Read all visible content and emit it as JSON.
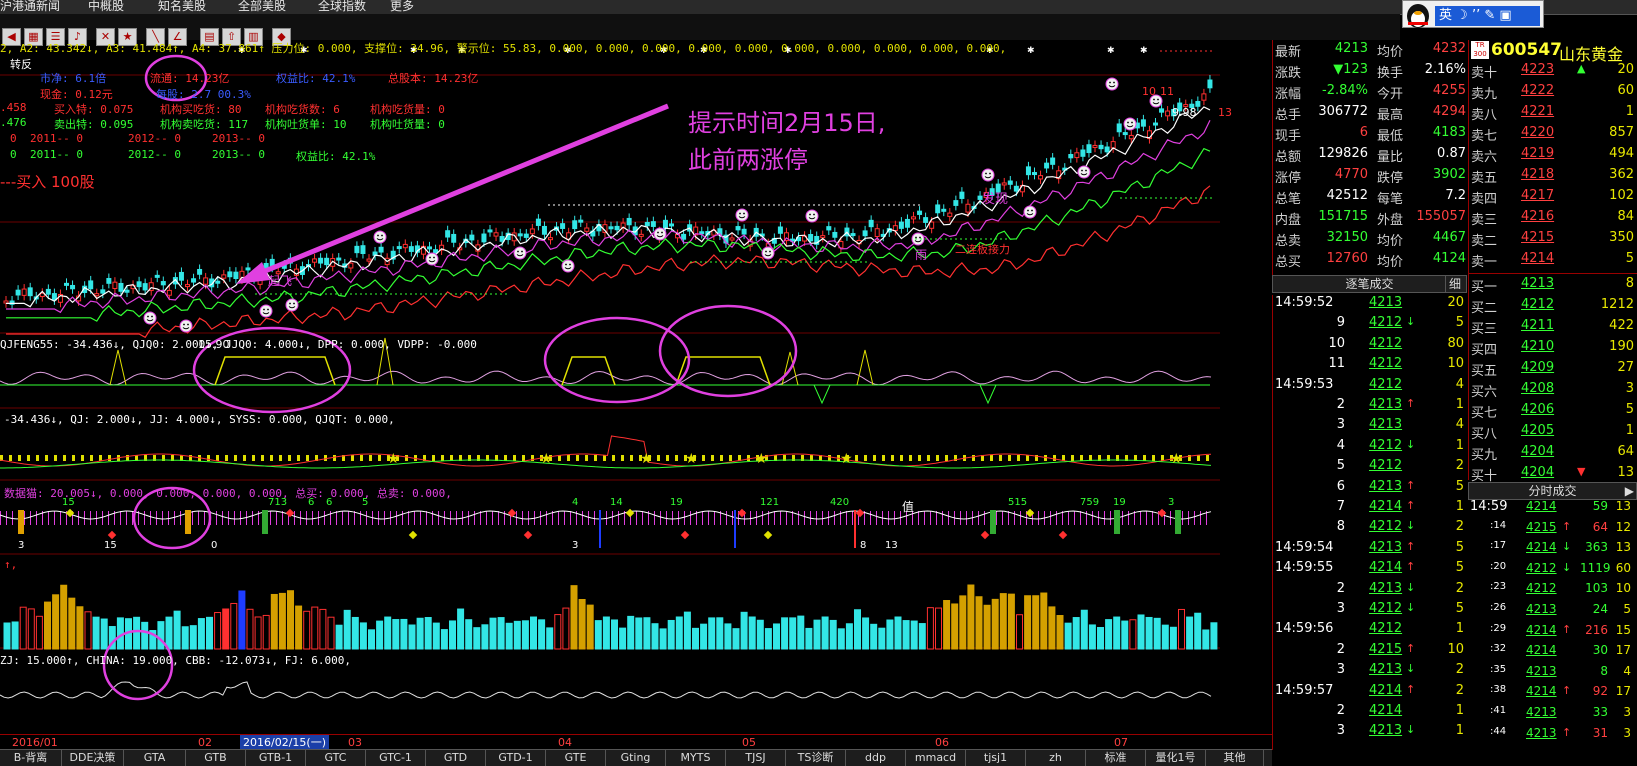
{
  "menu": [
    "沪港通新闻",
    "中概股",
    "知名美股",
    "全部美股",
    "全球指数",
    "更多"
  ],
  "qq_bar": {
    "ime_label": "英"
  },
  "info": {
    "ma_line": "2, A2: 43.342↓, A3: 41.484↑, A4: 37.861↑ 压力位: 0.000, 支撑位: 34.96, 警示位: 55.83, 0.000, 0.000, 0.000, 0.000, 0.000, 0.000, 0.000, 0.000, 0.000, 0.000,",
    "title": "转反",
    "row1": [
      {
        "text": "市净: 6.1倍",
        "color": "#3a5cff"
      },
      {
        "text": "流通: 14.23亿",
        "color": "#ff3030"
      },
      {
        "text": "权益比: 42.1%",
        "color": "#3a5cff"
      },
      {
        "text": "总股本: 14.23亿",
        "color": "#ff3030"
      }
    ],
    "row2": [
      {
        "text": "现金: 0.12元",
        "color": "#ff3030"
      },
      {
        "text": "每股: 2.7 00.3%",
        "color": "#3a5cff"
      }
    ],
    "row3": [
      {
        "text": ".458",
        "color": "#ff3030"
      },
      {
        "text": "买入特: 0.075",
        "color": "#ff3030"
      },
      {
        "text": "机构买吃货: 80",
        "color": "#ff3030"
      },
      {
        "text": "机构吃货数: 6",
        "color": "#ff3030"
      },
      {
        "text": "机构吃货量: 0",
        "color": "#ff3030"
      }
    ],
    "row4": [
      {
        "text": ".476",
        "color": "#33ff33"
      },
      {
        "text": "卖出特: 0.095",
        "color": "#33ff33"
      },
      {
        "text": "机构卖吃货: 117",
        "color": "#33ff33"
      },
      {
        "text": "机构吐货单: 10",
        "color": "#33ff33"
      },
      {
        "text": "机构吐货量: 0",
        "color": "#33ff33"
      }
    ],
    "row5": [
      {
        "text": "0",
        "color": "#ff3030"
      },
      {
        "text": "2011-- 0",
        "color": "#ff3030"
      },
      {
        "text": "2012-- 0",
        "color": "#ff3030"
      },
      {
        "text": "2013-- 0",
        "color": "#ff3030"
      }
    ],
    "row6": [
      {
        "text": "0",
        "color": "#33ff33"
      },
      {
        "text": "2011-- 0",
        "color": "#33ff33"
      },
      {
        "text": "2012-- 0",
        "color": "#33ff33"
      },
      {
        "text": "2013-- 0",
        "color": "#33ff33"
      },
      {
        "text": "权益比: 42.1%",
        "color": "#33ff33"
      }
    ],
    "buy_signal": "---买入 100股"
  },
  "annotation": {
    "line1": "提示时间2月15日,",
    "line2": "此前两涨停"
  },
  "chart_labels": {
    "low_price": "15.90",
    "high_ticks": [
      "10",
      "11",
      "9.98",
      "13"
    ],
    "faxian": "发现",
    "zhangting": "二连板接力",
    "yu": "雨",
    "qifei": "起飞",
    "zhi": "值"
  },
  "indicators": {
    "panel2": "QJFENG55: -34.436↓, QJQ0: 2.000↓, JJQ0: 4.000↓, DPP: 0.000, VDPP: -0.000",
    "panel3": "-34.436↓, QJ: 2.000↓, JJ: 4.000↓, SYSS: 0.000, QJQT: 0.000,",
    "panel4": "数据猫: 20.005↓, 0.000, 0.000, 0.000, 0.000, 总买: 0.000, 总卖: 0.000,",
    "panel5": "↑,",
    "panel6": "ZJ: 15.000↑, CHINA: 19.000, CBB: -12.073↓, FJ: 6.000,",
    "panel4_numbers": [
      "15",
      "713",
      "6",
      "6",
      "5",
      "4",
      "14",
      "19",
      "121",
      "420",
      "515",
      "759",
      "19",
      "3"
    ],
    "panel4_bottom": [
      "3",
      "15",
      "0",
      "3",
      "8",
      "13"
    ]
  },
  "dates": [
    "2016/01",
    "02",
    "2016/02/15(一)",
    "03",
    "04",
    "05",
    "06",
    "07"
  ],
  "tabs": [
    "B-背离",
    "DDE决策",
    "GTA",
    "GTB",
    "GTB-1",
    "GTC",
    "GTC-1",
    "GTD",
    "GTD-1",
    "GTE",
    "Gting",
    "MYTS",
    "TJSJ",
    "TS诊断",
    "ddp",
    "mmacd",
    "tjsj1",
    "zh",
    "标准",
    "量化1号",
    "其他"
  ],
  "quote": {
    "rows": [
      {
        "l1": "最新",
        "v1": "4213",
        "c1": "dn",
        "l2": "均价",
        "v2": "4232",
        "c2": "up"
      },
      {
        "l1": "涨跌",
        "v1": "▼123",
        "c1": "dn",
        "l2": "换手",
        "v2": "2.16%",
        "c2": "wh"
      },
      {
        "l1": "涨幅",
        "v1": "-2.84%",
        "c1": "dn",
        "l2": "今开",
        "v2": "4255",
        "c2": "up"
      },
      {
        "l1": "总手",
        "v1": "306772",
        "c1": "wh",
        "l2": "最高",
        "v2": "4294",
        "c2": "up"
      },
      {
        "l1": "现手",
        "v1": "6",
        "c1": "up",
        "l2": "最低",
        "v2": "4183",
        "c2": "dn"
      },
      {
        "l1": "总额",
        "v1": "129826",
        "c1": "wh",
        "l2": "量比",
        "v2": "0.87",
        "c2": "wh"
      },
      {
        "l1": "涨停",
        "v1": "4770",
        "c1": "up",
        "l2": "跌停",
        "v2": "3902",
        "c2": "dn"
      },
      {
        "l1": "总笔",
        "v1": "42512",
        "c1": "wh",
        "l2": "每笔",
        "v2": "7.2",
        "c2": "wh"
      },
      {
        "l1": "内盘",
        "v1": "151715",
        "c1": "dn",
        "l2": "外盘",
        "v2": "155057",
        "c2": "up"
      },
      {
        "l1": "总卖",
        "v1": "32150",
        "c1": "dn",
        "l2": "均价",
        "v2": "4467",
        "c2": "dn"
      },
      {
        "l1": "总买",
        "v1": "12760",
        "c1": "up",
        "l2": "均价",
        "v2": "4124",
        "c2": "dn"
      }
    ]
  },
  "stock": {
    "badge": "TR 300",
    "code": "600547",
    "name": "山东黄金"
  },
  "orderbook": [
    {
      "label": "卖十",
      "price": "4223",
      "vol": "20",
      "mark": "▲"
    },
    {
      "label": "卖九",
      "price": "4222",
      "vol": "60",
      "mark": ""
    },
    {
      "label": "卖八",
      "price": "4221",
      "vol": "1",
      "mark": ""
    },
    {
      "label": "卖七",
      "price": "4220",
      "vol": "857",
      "mark": ""
    },
    {
      "label": "卖六",
      "price": "4219",
      "vol": "494",
      "mark": ""
    },
    {
      "label": "卖五",
      "price": "4218",
      "vol": "362",
      "mark": ""
    },
    {
      "label": "卖四",
      "price": "4217",
      "vol": "102",
      "mark": ""
    },
    {
      "label": "卖三",
      "price": "4216",
      "vol": "84",
      "mark": ""
    },
    {
      "label": "卖二",
      "price": "4215",
      "vol": "350",
      "mark": ""
    },
    {
      "label": "卖一",
      "price": "4214",
      "vol": "5",
      "mark": ""
    },
    {
      "label": "买一",
      "price": "4213",
      "vol": "8",
      "mark": ""
    },
    {
      "label": "买二",
      "price": "4212",
      "vol": "1212",
      "mark": ""
    },
    {
      "label": "买三",
      "price": "4211",
      "vol": "422",
      "mark": ""
    },
    {
      "label": "买四",
      "price": "4210",
      "vol": "190",
      "mark": ""
    },
    {
      "label": "买五",
      "price": "4209",
      "vol": "27",
      "mark": ""
    },
    {
      "label": "买六",
      "price": "4208",
      "vol": "3",
      "mark": ""
    },
    {
      "label": "买七",
      "price": "4206",
      "vol": "5",
      "mark": ""
    },
    {
      "label": "买八",
      "price": "4205",
      "vol": "1",
      "mark": ""
    },
    {
      "label": "买九",
      "price": "4204",
      "vol": "64",
      "mark": ""
    },
    {
      "label": "买十",
      "price": "4204",
      "vol": "13",
      "mark": "▼"
    }
  ],
  "tick_header": "逐笔成交",
  "tick_header_btn": "细",
  "ticks": [
    {
      "t": "14:59:52",
      "p": "4213",
      "d": "",
      "v": "20"
    },
    {
      "t": "9",
      "p": "4212",
      "d": "↓",
      "v": "5"
    },
    {
      "t": "10",
      "p": "4212",
      "d": "",
      "v": "80"
    },
    {
      "t": "11",
      "p": "4212",
      "d": "",
      "v": "10"
    },
    {
      "t": "14:59:53",
      "p": "4212",
      "d": "",
      "v": "4"
    },
    {
      "t": "2",
      "p": "4213",
      "d": "↑",
      "v": "1"
    },
    {
      "t": "3",
      "p": "4213",
      "d": "",
      "v": "4"
    },
    {
      "t": "4",
      "p": "4212",
      "d": "↓",
      "v": "1"
    },
    {
      "t": "5",
      "p": "4212",
      "d": "",
      "v": "2"
    },
    {
      "t": "6",
      "p": "4213",
      "d": "↑",
      "v": "5"
    },
    {
      "t": "7",
      "p": "4214",
      "d": "↑",
      "v": "1"
    },
    {
      "t": "8",
      "p": "4212",
      "d": "↓",
      "v": "2"
    },
    {
      "t": "14:59:54",
      "p": "4213",
      "d": "↑",
      "v": "5"
    },
    {
      "t": "14:59:55",
      "p": "4214",
      "d": "↑",
      "v": "5"
    },
    {
      "t": "2",
      "p": "4213",
      "d": "↓",
      "v": "2"
    },
    {
      "t": "3",
      "p": "4212",
      "d": "↓",
      "v": "5"
    },
    {
      "t": "14:59:56",
      "p": "4212",
      "d": "",
      "v": "1"
    },
    {
      "t": "2",
      "p": "4215",
      "d": "↑",
      "v": "10"
    },
    {
      "t": "3",
      "p": "4213",
      "d": "↓",
      "v": "2"
    },
    {
      "t": "14:59:57",
      "p": "4214",
      "d": "↑",
      "v": "2"
    },
    {
      "t": "2",
      "p": "4214",
      "d": "",
      "v": "1"
    },
    {
      "t": "3",
      "p": "4213",
      "d": "↓",
      "v": "1"
    }
  ],
  "minute_header": "分时成交",
  "minute_ticks": [
    {
      "t": "14:59",
      "p": "4214",
      "d": "",
      "v": "59",
      "v2": "13"
    },
    {
      "t": ":14",
      "p": "4215",
      "d": "↑",
      "v": "64",
      "v2": "12"
    },
    {
      "t": ":17",
      "p": "4214",
      "d": "↓",
      "v": "363",
      "v2": "13"
    },
    {
      "t": ":20",
      "p": "4212",
      "d": "↓",
      "v": "1119",
      "v2": "60"
    },
    {
      "t": ":23",
      "p": "4212",
      "d": "",
      "v": "103",
      "v2": "10"
    },
    {
      "t": ":26",
      "p": "4213",
      "d": "",
      "v": "24",
      "v2": "5"
    },
    {
      "t": ":29",
      "p": "4214",
      "d": "↑",
      "v": "216",
      "v2": "15"
    },
    {
      "t": ":32",
      "p": "4214",
      "d": "",
      "v": "30",
      "v2": "17"
    },
    {
      "t": ":35",
      "p": "4213",
      "d": "",
      "v": "8",
      "v2": "4"
    },
    {
      "t": ":38",
      "p": "4214",
      "d": "↑",
      "v": "92",
      "v2": "17"
    },
    {
      "t": ":41",
      "p": "4213",
      "d": "",
      "v": "33",
      "v2": "3"
    },
    {
      "t": ":44",
      "p": "4213",
      "d": "↑",
      "v": "31",
      "v2": "3"
    }
  ]
}
